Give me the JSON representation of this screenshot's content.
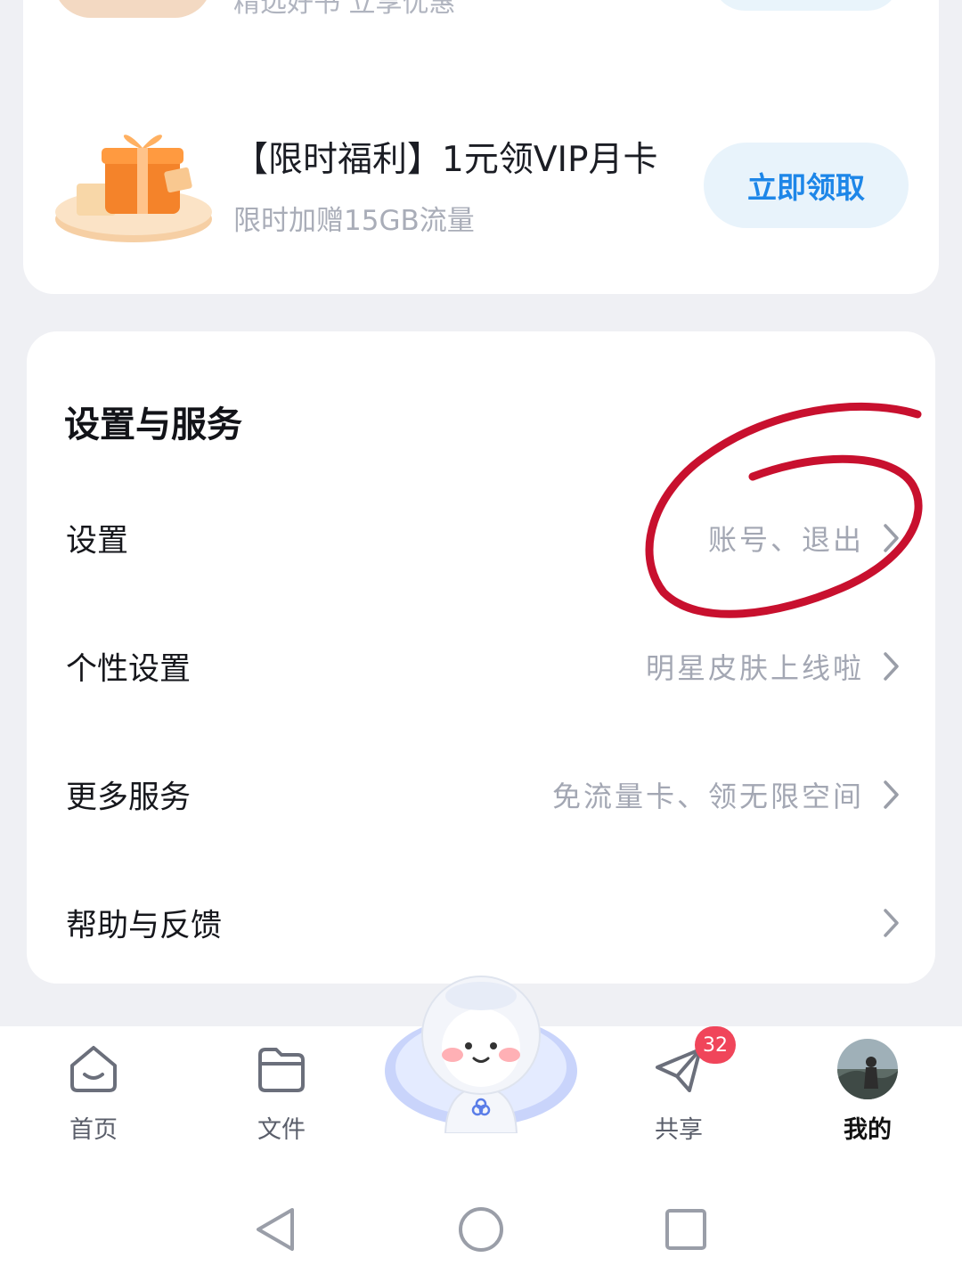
{
  "promo_top": {
    "subtitle": "精选好书 立享优惠"
  },
  "promo": {
    "title": "【限时福利】1元领VIP月卡",
    "subtitle": "限时加赠15GB流量",
    "button_label": "立即领取"
  },
  "settings": {
    "section_title": "设置与服务",
    "rows": [
      {
        "label": "设置",
        "hint": "账号、退出"
      },
      {
        "label": "个性设置",
        "hint": "明星皮肤上线啦"
      },
      {
        "label": "更多服务",
        "hint": "免流量卡、领无限空间"
      },
      {
        "label": "帮助与反馈",
        "hint": ""
      }
    ]
  },
  "tabbar": {
    "tabs": [
      {
        "label": "首页",
        "icon": "home-icon"
      },
      {
        "label": "文件",
        "icon": "folder-icon"
      },
      {
        "label": "",
        "icon": "mascot-icon"
      },
      {
        "label": "共享",
        "icon": "share-plane-icon",
        "badge": "32"
      },
      {
        "label": "我的",
        "icon": "avatar",
        "active": true
      }
    ]
  },
  "colors": {
    "accent_blue": "#1d86e8",
    "badge_red": "#f0455a",
    "annotation_red": "#c8102e"
  }
}
